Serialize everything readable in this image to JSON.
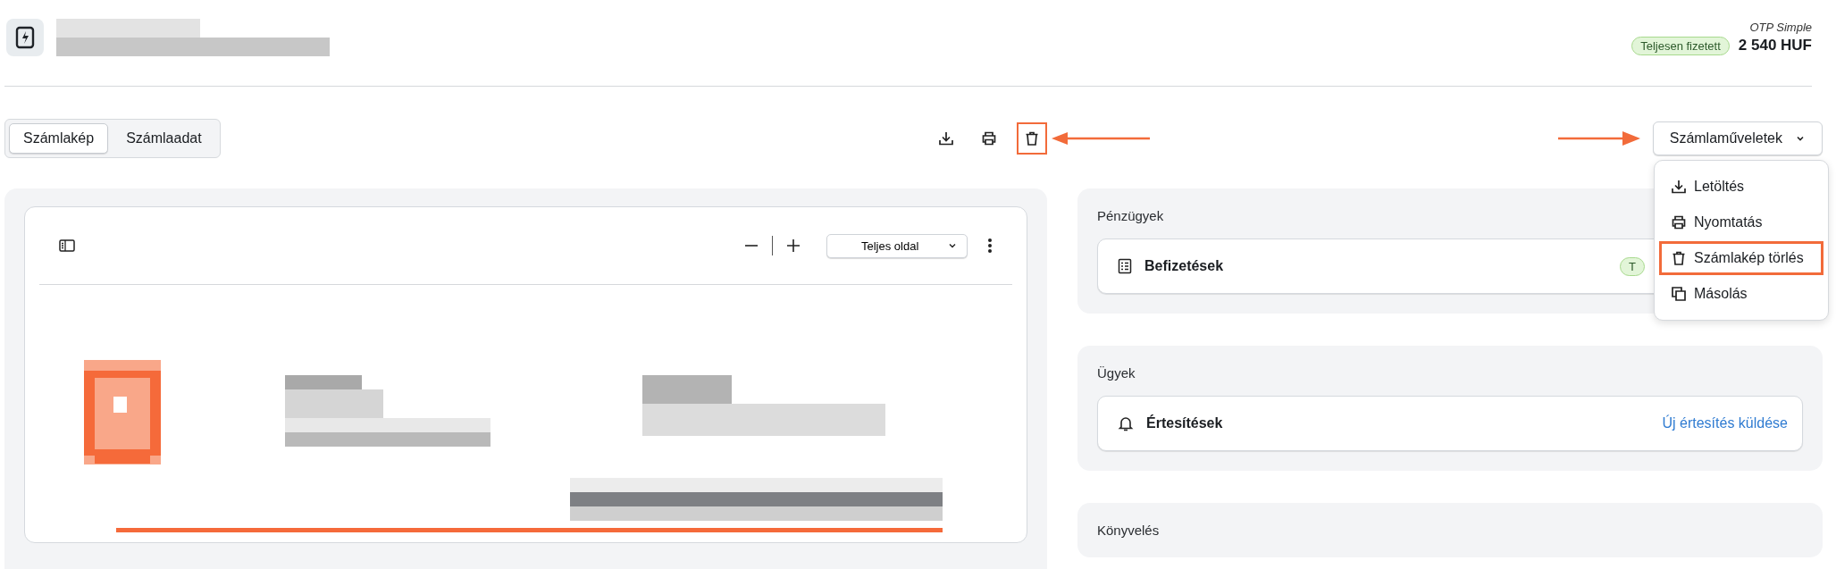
{
  "header": {
    "amount_caption": "OTP Simple",
    "status_badge": "Teljesen fizetett",
    "amount": "2 540 HUF"
  },
  "view_tabs": [
    {
      "label": "Számlakép",
      "selected": true
    },
    {
      "label": "Számlaadat",
      "selected": false
    }
  ],
  "toolbar_icons": [
    {
      "kind": "download",
      "highlighted": false
    },
    {
      "kind": "print",
      "highlighted": false
    },
    {
      "kind": "trash",
      "highlighted": true
    }
  ],
  "actions_button": {
    "label": "Számlaműveletek",
    "expanded": true
  },
  "actions_menu": [
    {
      "label": "Letöltés",
      "kind": "download",
      "highlighted": false
    },
    {
      "label": "Nyomtatás",
      "kind": "print",
      "highlighted": false
    },
    {
      "label": "Számlakép törlés",
      "kind": "trash",
      "highlighted": true
    },
    {
      "label": "Másolás",
      "kind": "copy",
      "highlighted": false
    }
  ],
  "viewer": {
    "page_fit": "Teljes oldal"
  },
  "panels": [
    {
      "title": "Pénzügyek",
      "rows": [
        {
          "kind": "ledger",
          "label": "Befizetések",
          "badge": "T"
        }
      ]
    },
    {
      "title": "Ügyek",
      "rows": [
        {
          "kind": "bell",
          "label": "Értesítések",
          "link": "Új értesítés küldése"
        }
      ]
    },
    {
      "title": "Könyvelés"
    }
  ]
}
